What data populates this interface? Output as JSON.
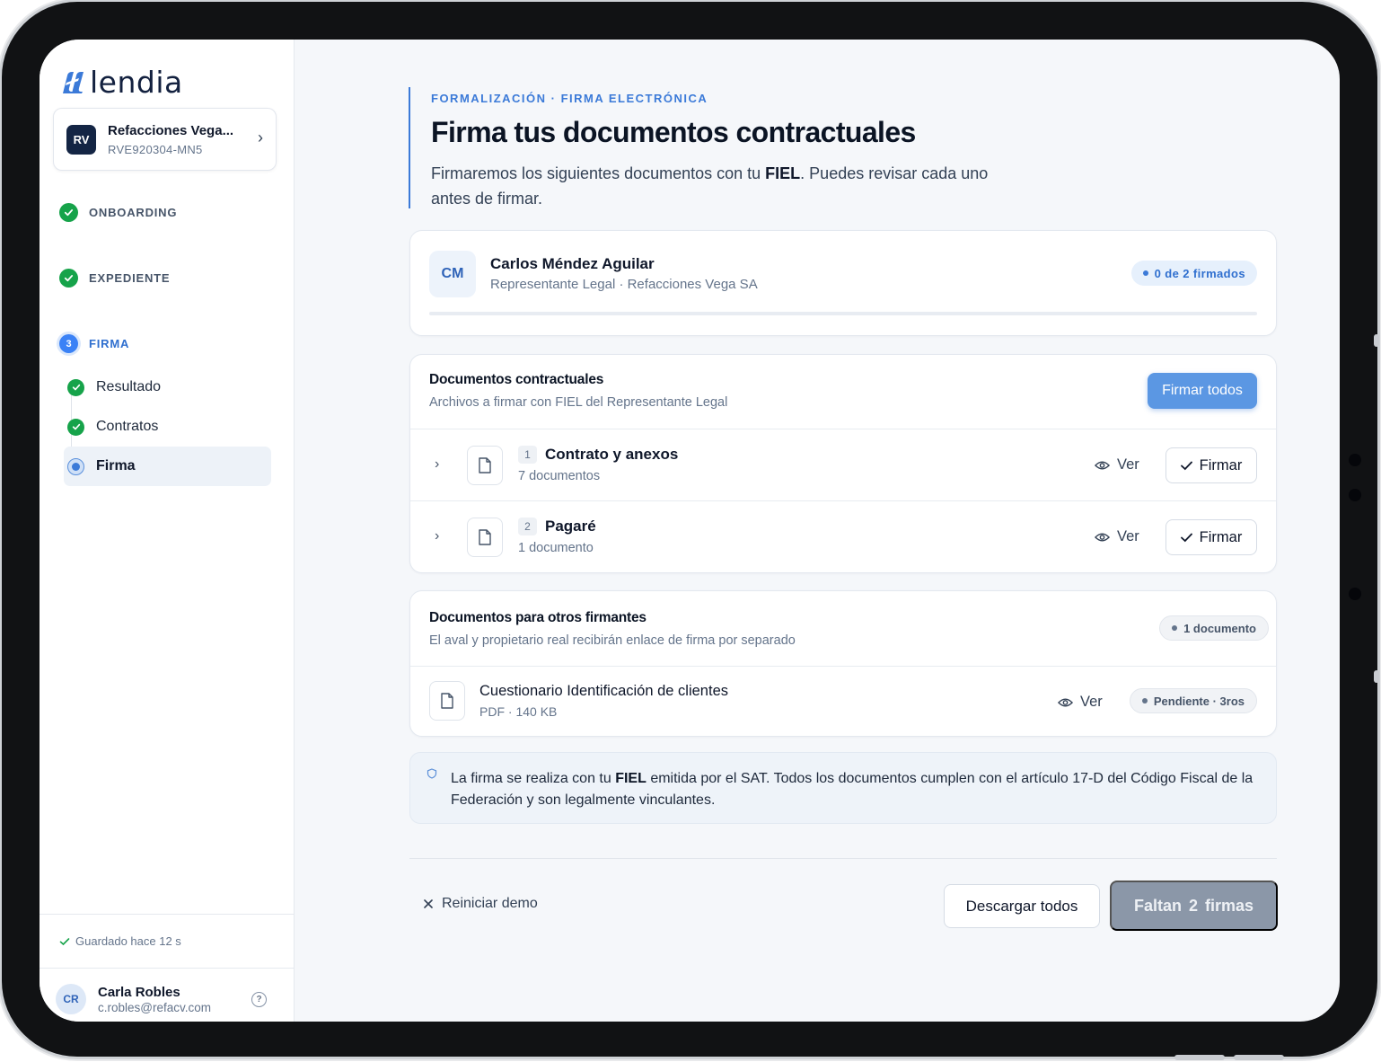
{
  "brand": {
    "name": "lendia",
    "accent": "#3b7ad8"
  },
  "company": {
    "initials": "RV",
    "name": "Refacciones Vega...",
    "rfc": "RVE920304-MN5"
  },
  "steps": [
    {
      "label": "ONBOARDING",
      "status": "done"
    },
    {
      "label": "EXPEDIENTE",
      "status": "done"
    },
    {
      "label": "FIRMA",
      "status": "current",
      "number": "3"
    }
  ],
  "substeps": [
    {
      "label": "Resultado",
      "status": "done"
    },
    {
      "label": "Contratos",
      "status": "done"
    },
    {
      "label": "Firma",
      "status": "current"
    }
  ],
  "saved_status": "Guardado hace 12 s",
  "user": {
    "initials": "CR",
    "name": "Carla Robles",
    "email": "c.robles@refacv.com",
    "help_icon": "help-circle-icon"
  },
  "header": {
    "eyebrow": "FORMALIZACIÓN · FIRMA ELECTRÓNICA",
    "title": "Firma tus documentos contractuales",
    "subtitle_pre": "Firmaremos los siguientes documentos con tu ",
    "subtitle_bold": "FIEL",
    "subtitle_post": ". Puedes revisar cada uno antes de firmar."
  },
  "signer": {
    "initials": "CM",
    "name": "Carlos Méndez Aguilar",
    "role": "Representante Legal · Refacciones Vega SA",
    "progress_label": "0 de 2 firmados",
    "signed": 0,
    "total": 2
  },
  "contract_docs": {
    "title": "Documentos contractuales",
    "subtitle": "Archivos a firmar con FIEL del Representante Legal",
    "sign_all_label": "Firmar todos",
    "items": [
      {
        "number": "1",
        "name": "Contrato y anexos",
        "count": "7 documentos",
        "view_label": "Ver",
        "sign_label": "Firmar"
      },
      {
        "number": "2",
        "name": "Pagaré",
        "count": "1 documento",
        "view_label": "Ver",
        "sign_label": "Firmar"
      }
    ]
  },
  "other_docs": {
    "title": "Documentos para otros firmantes",
    "subtitle": "El aval y propietario real recibirán enlace de firma por separado",
    "badge": "1 documento",
    "items": [
      {
        "name": "Cuestionario Identificación de clientes",
        "meta": "PDF · 140 KB",
        "view_label": "Ver",
        "status": "Pendiente · 3ros"
      }
    ]
  },
  "legal_note": {
    "pre": "La firma se realiza con tu ",
    "bold": "FIEL",
    "post": " emitida por el SAT. Todos los documentos cumplen con el artículo 17-D del Código Fiscal de la Federación y son legalmente vinculantes."
  },
  "footer": {
    "reset_label": "Reiniciar demo",
    "download_label": "Descargar todos",
    "remaining_label": "Faltan  2  firmas"
  }
}
